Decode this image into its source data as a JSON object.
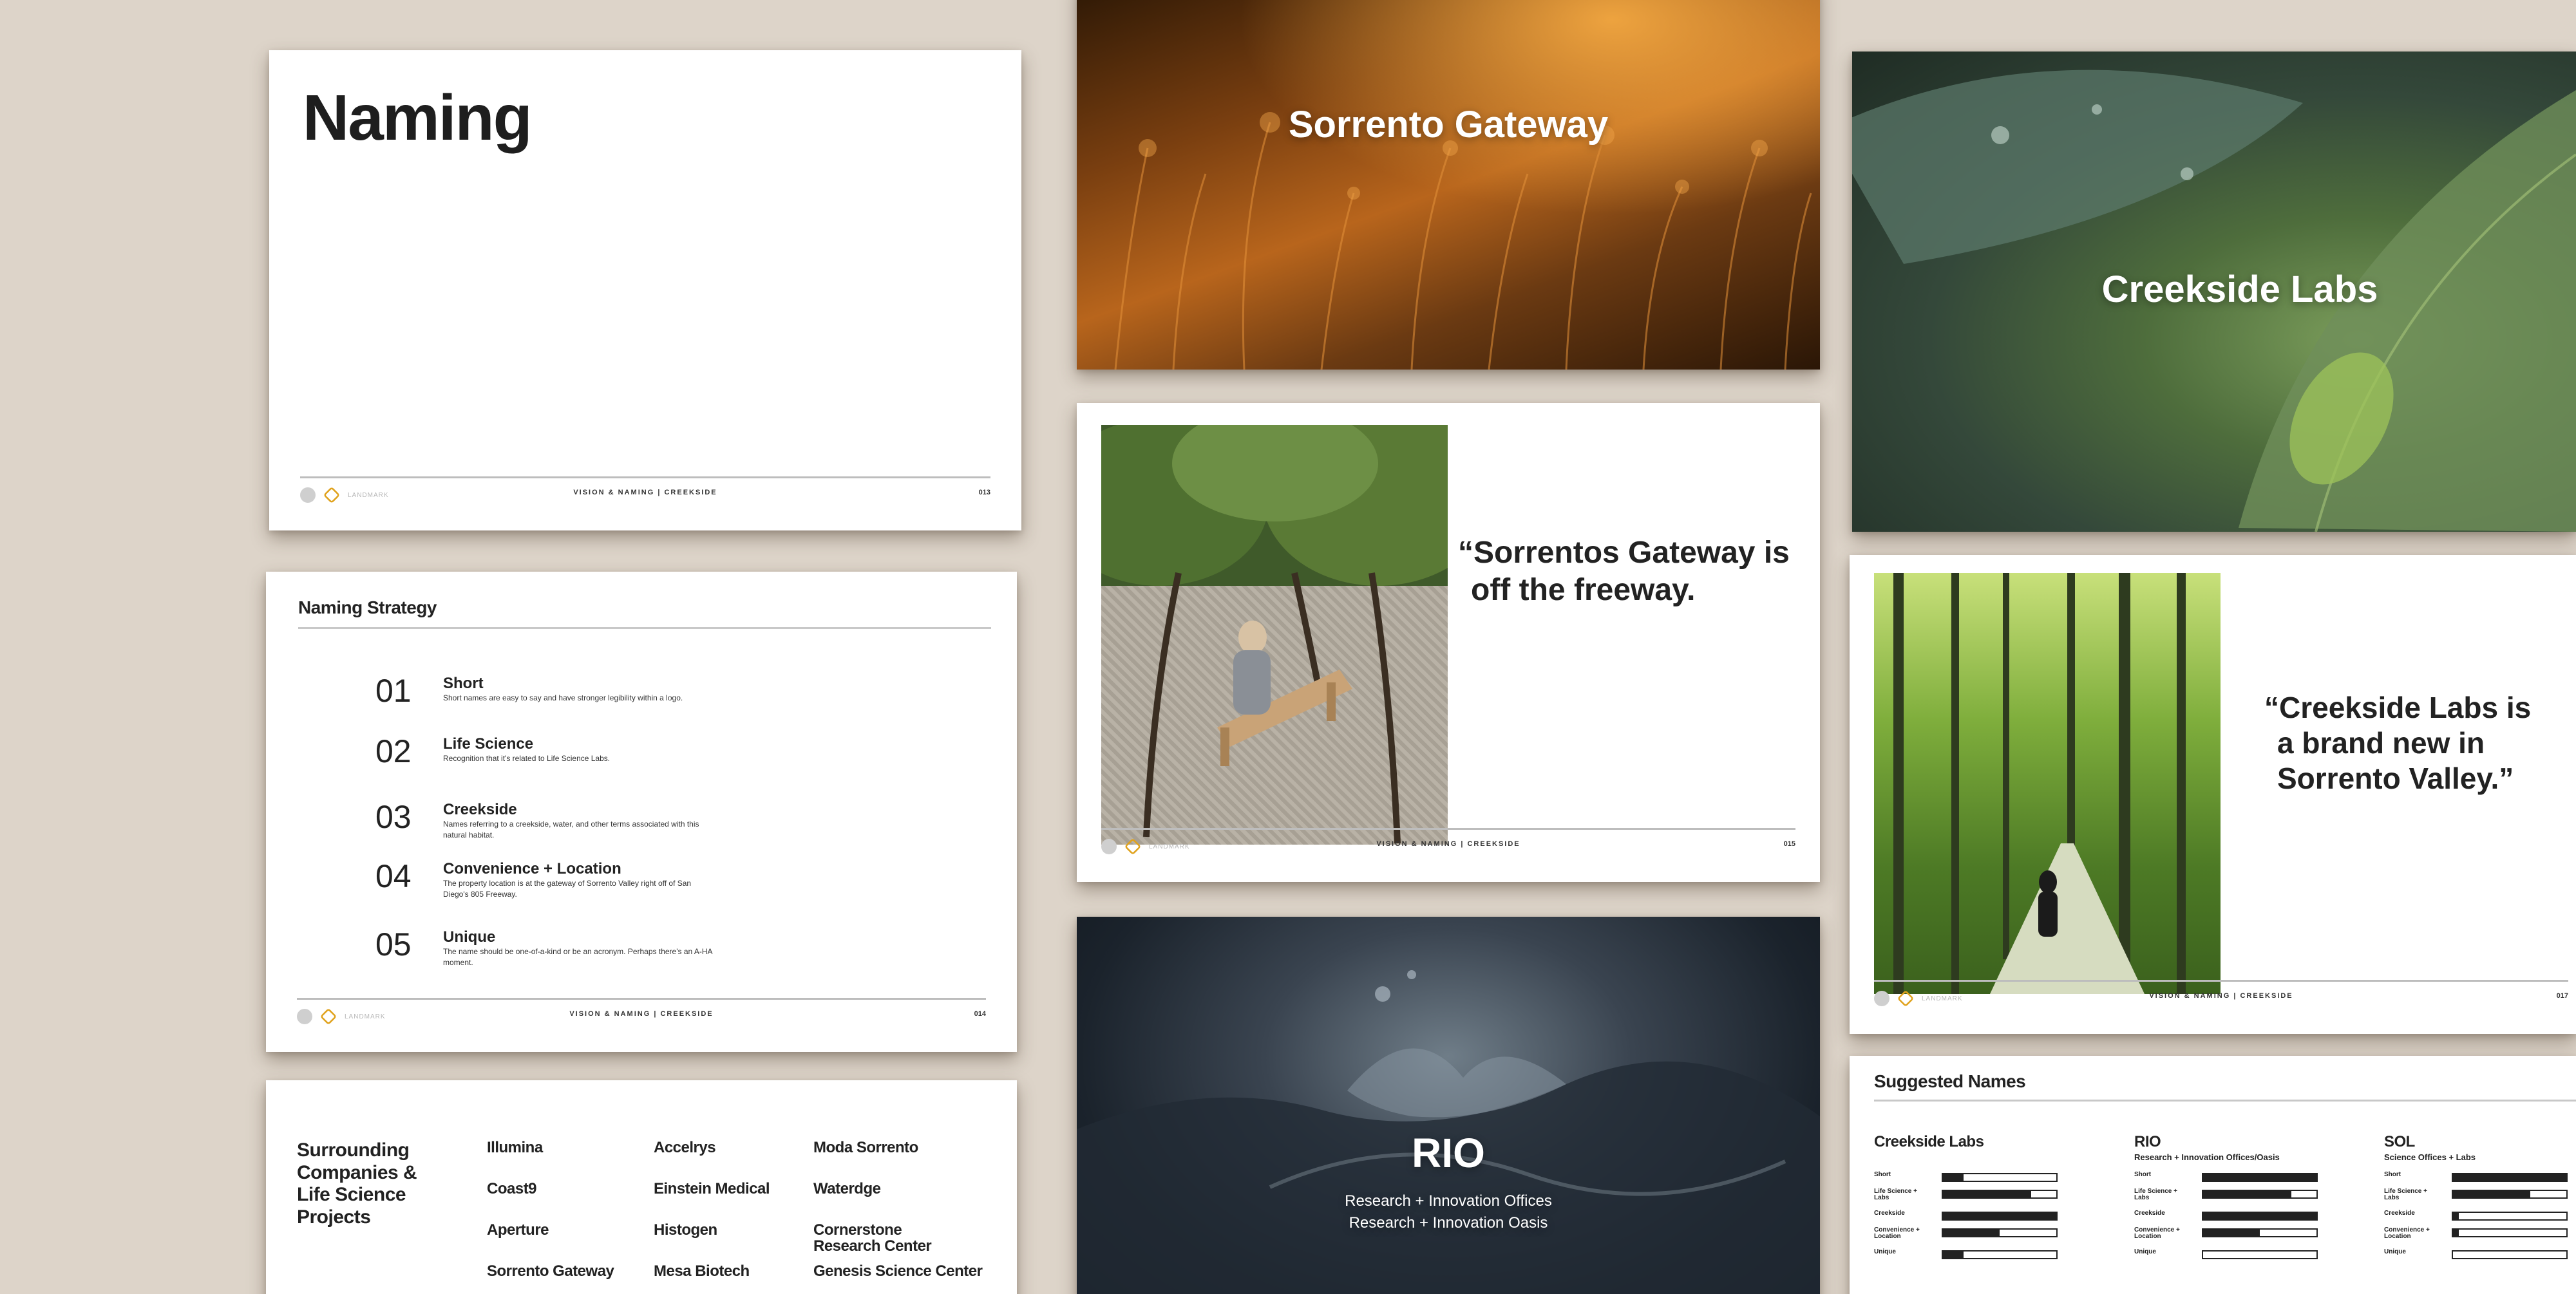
{
  "footer": {
    "brand": "LANDMARK",
    "center": "VISION & NAMING  |  CREEKSIDE",
    "pages": {
      "naming": "013",
      "strategy": "014",
      "sorrento_quote": "015",
      "creekside_quote": "017"
    }
  },
  "naming_slide": {
    "title": "Naming"
  },
  "strategy": {
    "heading": "Naming Strategy",
    "items": [
      {
        "num": "01",
        "title": "Short",
        "desc": "Short names are easy to say and have stronger legibility within a logo."
      },
      {
        "num": "02",
        "title": "Life Science",
        "desc": "Recognition that it's related to Life Science Labs."
      },
      {
        "num": "03",
        "title": "Creekside",
        "desc": "Names referring to a creekside, water, and other terms associated with this natural habitat."
      },
      {
        "num": "04",
        "title": "Convenience + Location",
        "desc": "The property location is at the gateway of Sorrento Valley right off of San Diego's 805 Freeway."
      },
      {
        "num": "05",
        "title": "Unique",
        "desc": "The name should be one-of-a-kind or be an acronym. Perhaps there's an A-HA moment."
      }
    ]
  },
  "surrounding": {
    "heading": "Surrounding Companies & Life Science Projects",
    "columns": [
      [
        "Illumina",
        "Coast9",
        "Aperture",
        "Sorrento Gateway"
      ],
      [
        "Accelrys",
        "Einstein Medical",
        "Histogen",
        "Mesa Biotech"
      ],
      [
        "Moda Sorrento",
        "Waterdge",
        "Cornerstone Research Center",
        "Genesis Science Center"
      ]
    ]
  },
  "sorrento_gateway": {
    "title": "Sorrento Gateway"
  },
  "sorrento_quote": {
    "quote": "“Sorrentos Gateway is off the freeway."
  },
  "rio": {
    "title": "RIO",
    "line1": "Research + Innovation Offices",
    "line2": "Research + Innovation Oasis"
  },
  "creekside_labs": {
    "title": "Creekside Labs"
  },
  "creekside_quote": {
    "quote": "“Creekside Labs is a brand new in Sorrento Valley.”"
  },
  "suggested": {
    "heading": "Suggested Names",
    "criteria": [
      "Short",
      "Life Science + Labs",
      "Creekside",
      "Convenience + Location",
      "Unique"
    ],
    "names": [
      {
        "name": "Creekside Labs",
        "sub": "",
        "scores": [
          0.18,
          0.78,
          1.0,
          0.5,
          0.18
        ]
      },
      {
        "name": "RIO",
        "sub": "Research + Innovation Offices/Oasis",
        "scores": [
          1.0,
          0.78,
          1.0,
          0.5,
          0.0
        ]
      },
      {
        "name": "SOL",
        "sub": "Science Offices + Labs",
        "scores": [
          1.0,
          0.68,
          0.05,
          0.05,
          0.0
        ]
      }
    ]
  },
  "colors": {
    "background": "#ddd4c9",
    "accent": "#e0a21c",
    "text": "#1e1e1e"
  }
}
